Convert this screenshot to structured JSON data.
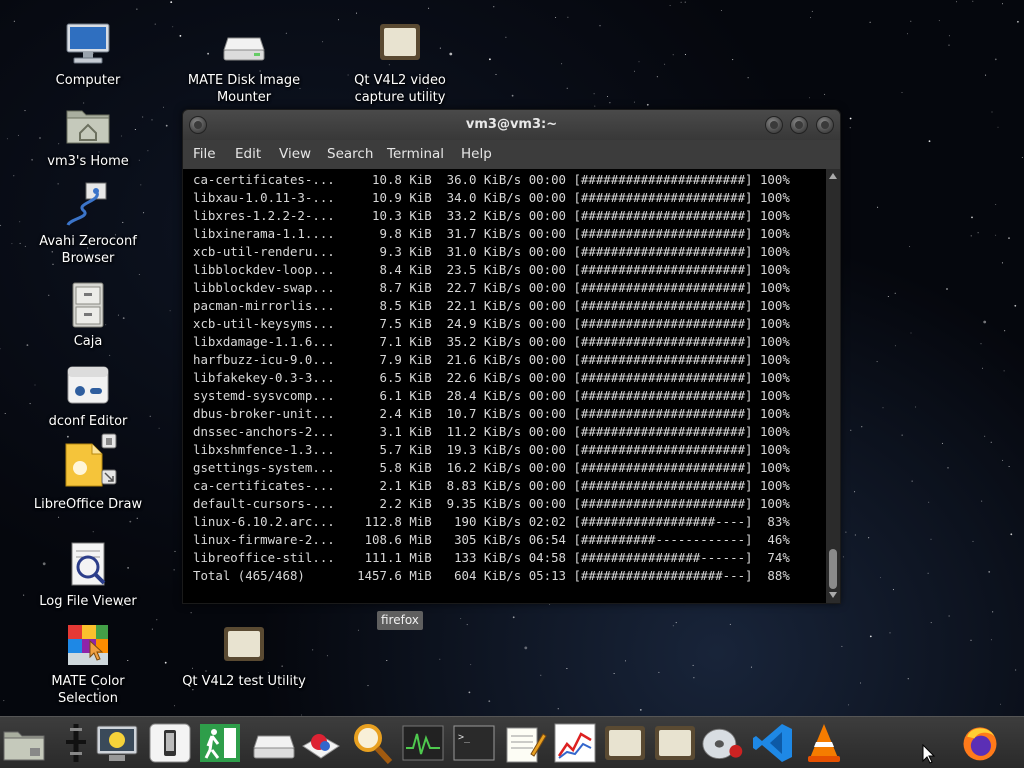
{
  "desktop": {
    "icons": [
      {
        "label": "Computer"
      },
      {
        "label": "vm3's Home"
      },
      {
        "label": "Avahi Zeroconf Browser"
      },
      {
        "label": "Caja"
      },
      {
        "label": "dconf Editor"
      },
      {
        "label": "LibreOffice Draw"
      },
      {
        "label": "Log File Viewer"
      },
      {
        "label": "MATE Color Selection"
      },
      {
        "label": "MATE Disk Image Mounter"
      },
      {
        "label": "Qt V4L2 video capture utility"
      },
      {
        "label": "Qt V4L2 test Utility"
      }
    ]
  },
  "terminal": {
    "title": "vm3@vm3:~",
    "menu": [
      "File",
      "Edit",
      "View",
      "Search",
      "Terminal",
      "Help"
    ],
    "lines": [
      "ca-certificates-...     10.8 KiB  36.0 KiB/s 00:00 [######################] 100%",
      "libxau-1.0.11-3-...     10.9 KiB  34.0 KiB/s 00:00 [######################] 100%",
      "libxres-1.2.2-2-...     10.3 KiB  33.2 KiB/s 00:00 [######################] 100%",
      "libxinerama-1.1....      9.8 KiB  31.7 KiB/s 00:00 [######################] 100%",
      "xcb-util-renderu...      9.3 KiB  31.0 KiB/s 00:00 [######################] 100%",
      "libblockdev-loop...      8.4 KiB  23.5 KiB/s 00:00 [######################] 100%",
      "libblockdev-swap...      8.7 KiB  22.7 KiB/s 00:00 [######################] 100%",
      "pacman-mirrorlis...      8.5 KiB  22.1 KiB/s 00:00 [######################] 100%",
      "xcb-util-keysyms...      7.5 KiB  24.9 KiB/s 00:00 [######################] 100%",
      "libxdamage-1.1.6...      7.1 KiB  35.2 KiB/s 00:00 [######################] 100%",
      "harfbuzz-icu-9.0...      7.9 KiB  21.6 KiB/s 00:00 [######################] 100%",
      "libfakekey-0.3-3...      6.5 KiB  22.6 KiB/s 00:00 [######################] 100%",
      "systemd-sysvcomp...      6.1 KiB  28.4 KiB/s 00:00 [######################] 100%",
      "dbus-broker-unit...      2.4 KiB  10.7 KiB/s 00:00 [######################] 100%",
      "dnssec-anchors-2...      3.1 KiB  11.2 KiB/s 00:00 [######################] 100%",
      "libxshmfence-1.3...      5.7 KiB  19.3 KiB/s 00:00 [######################] 100%",
      "gsettings-system...      5.8 KiB  16.2 KiB/s 00:00 [######################] 100%",
      "ca-certificates-...      2.1 KiB  8.83 KiB/s 00:00 [######################] 100%",
      "default-cursors-...      2.2 KiB  9.35 KiB/s 00:00 [######################] 100%",
      "linux-6.10.2.arc...    112.8 MiB   190 KiB/s 02:02 [##################----]  83%",
      "linux-firmware-2...    108.6 MiB   305 KiB/s 06:54 [##########------------]  46%",
      "libreoffice-stil...    111.1 MiB   133 KiB/s 04:58 [################------]  74%",
      "Total (465/468)       1457.6 MiB   604 KiB/s 05:13 [###################---]  88%"
    ]
  },
  "tooltip": {
    "text": "firefox"
  },
  "taskbar": {
    "items": [
      "files-icon",
      "volume-icon",
      "screensaver-icon",
      "phone-icon",
      "exit-icon",
      "disk-icon",
      "paint-icon",
      "magnifier-icon",
      "system-monitor-icon",
      "terminal-icon",
      "text-editor-icon",
      "chart-icon",
      "qt-v4l2-icon",
      "qt-v4l2-test-icon",
      "disc-icon",
      "vscode-icon",
      "vlc-icon",
      "firefox-icon"
    ]
  }
}
